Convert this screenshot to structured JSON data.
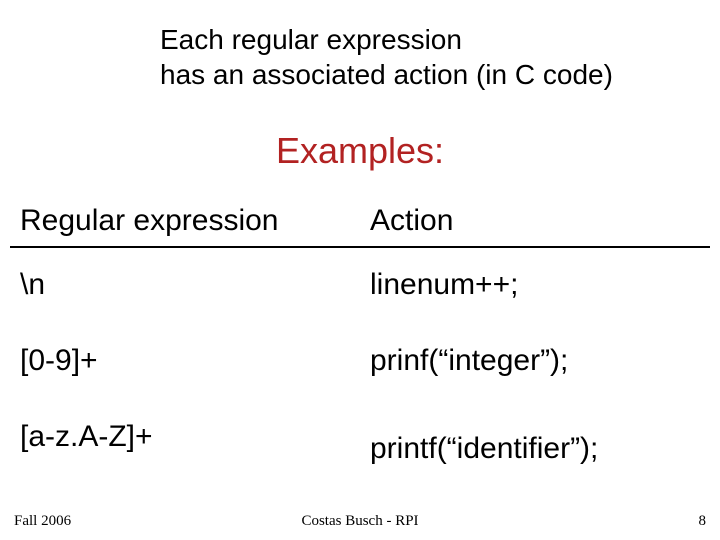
{
  "intro_line1": "Each regular expression",
  "intro_line2": "has an associated action (in C code)",
  "examples_heading": "Examples:",
  "columns": {
    "regex": "Regular expression",
    "action": "Action"
  },
  "rows": [
    {
      "regex": "\\n",
      "action": "linenum++;"
    },
    {
      "regex": "[0-9]+",
      "action": "prinf(“integer”);"
    },
    {
      "regex": "[a-z.A-Z]+",
      "action": "printf(“identifier”);"
    }
  ],
  "footer": {
    "left": "Fall 2006",
    "center": "Costas Busch - RPI",
    "right": "8"
  }
}
